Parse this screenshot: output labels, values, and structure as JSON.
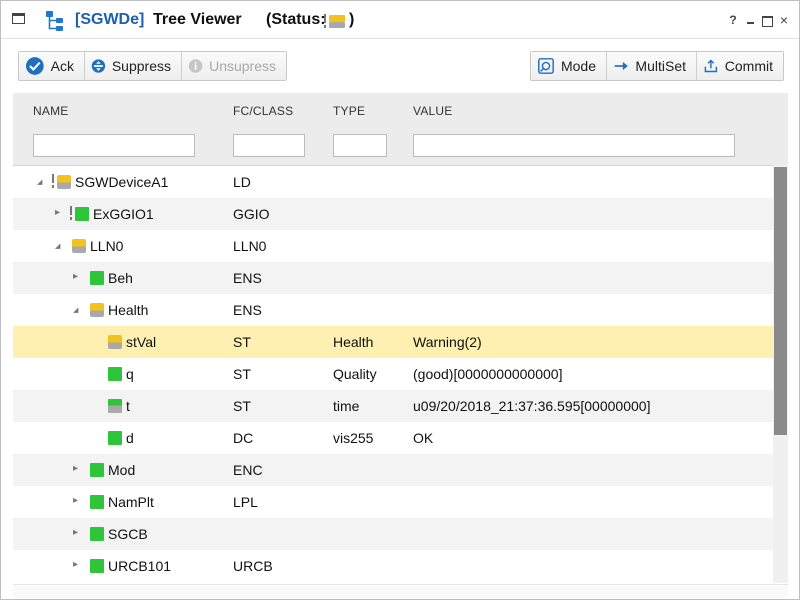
{
  "window": {
    "title_tag": "[SGWDe]",
    "title_name": "Tree Viewer",
    "status_label": "(Status:",
    "status_close": ")",
    "help": "?",
    "close": "×"
  },
  "toolbar_left": [
    {
      "label": "Ack",
      "icon": "check-circle-icon",
      "enabled": true
    },
    {
      "label": "Suppress",
      "icon": "suppress-icon",
      "enabled": true
    },
    {
      "label": "Unsupress",
      "icon": "info-icon",
      "enabled": false
    }
  ],
  "toolbar_right": [
    {
      "label": "Mode",
      "icon": "mode-icon",
      "enabled": true
    },
    {
      "label": "MultiSet",
      "icon": "arrow-right-icon",
      "enabled": true
    },
    {
      "label": "Commit",
      "icon": "commit-icon",
      "enabled": true
    }
  ],
  "columns": {
    "name": "NAME",
    "fc_class": "FC/CLASS",
    "type": "TYPE",
    "value": "VALUE"
  },
  "filters": {
    "name": "",
    "fc_class": "",
    "type": "",
    "value": ""
  },
  "rows": [
    {
      "name": "SGWDeviceA1",
      "fc": "LD",
      "type": "",
      "value": "",
      "indent": 0,
      "expander": "collapse",
      "status": "yellow",
      "alert": true
    },
    {
      "name": "ExGGIO1",
      "fc": "GGIO",
      "type": "",
      "value": "",
      "indent": 1,
      "expander": "expand",
      "status": "green",
      "alert": true
    },
    {
      "name": "LLN0",
      "fc": "LLN0",
      "type": "",
      "value": "",
      "indent": 1,
      "expander": "collapse",
      "status": "yellow",
      "alert": false
    },
    {
      "name": "Beh",
      "fc": "ENS",
      "type": "",
      "value": "",
      "indent": 2,
      "expander": "expand",
      "status": "green",
      "alert": false
    },
    {
      "name": "Health",
      "fc": "ENS",
      "type": "",
      "value": "",
      "indent": 2,
      "expander": "collapse",
      "status": "yellow",
      "alert": false
    },
    {
      "name": "stVal",
      "fc": "ST",
      "type": "Health",
      "value": "Warning(2)",
      "indent": 3,
      "expander": "none",
      "status": "yellow",
      "alert": false,
      "selected": true
    },
    {
      "name": "q",
      "fc": "ST",
      "type": "Quality",
      "value": "(good)[0000000000000]",
      "indent": 3,
      "expander": "none",
      "status": "green",
      "alert": false
    },
    {
      "name": "t",
      "fc": "ST",
      "type": "time",
      "value": "u09/20/2018_21:37:36.595[00000000]",
      "indent": 3,
      "expander": "none",
      "status": "grayg",
      "alert": false
    },
    {
      "name": "d",
      "fc": "DC",
      "type": "vis255",
      "value": "OK",
      "indent": 3,
      "expander": "none",
      "status": "green",
      "alert": false
    },
    {
      "name": "Mod",
      "fc": "ENC",
      "type": "",
      "value": "",
      "indent": 2,
      "expander": "expand",
      "status": "green",
      "alert": false
    },
    {
      "name": "NamPlt",
      "fc": "LPL",
      "type": "",
      "value": "",
      "indent": 2,
      "expander": "expand",
      "status": "green",
      "alert": false
    },
    {
      "name": "SGCB",
      "fc": "",
      "type": "",
      "value": "",
      "indent": 2,
      "expander": "expand",
      "status": "green",
      "alert": false
    },
    {
      "name": "URCB101",
      "fc": "URCB",
      "type": "",
      "value": "",
      "indent": 2,
      "expander": "expand",
      "status": "green",
      "alert": false
    }
  ]
}
